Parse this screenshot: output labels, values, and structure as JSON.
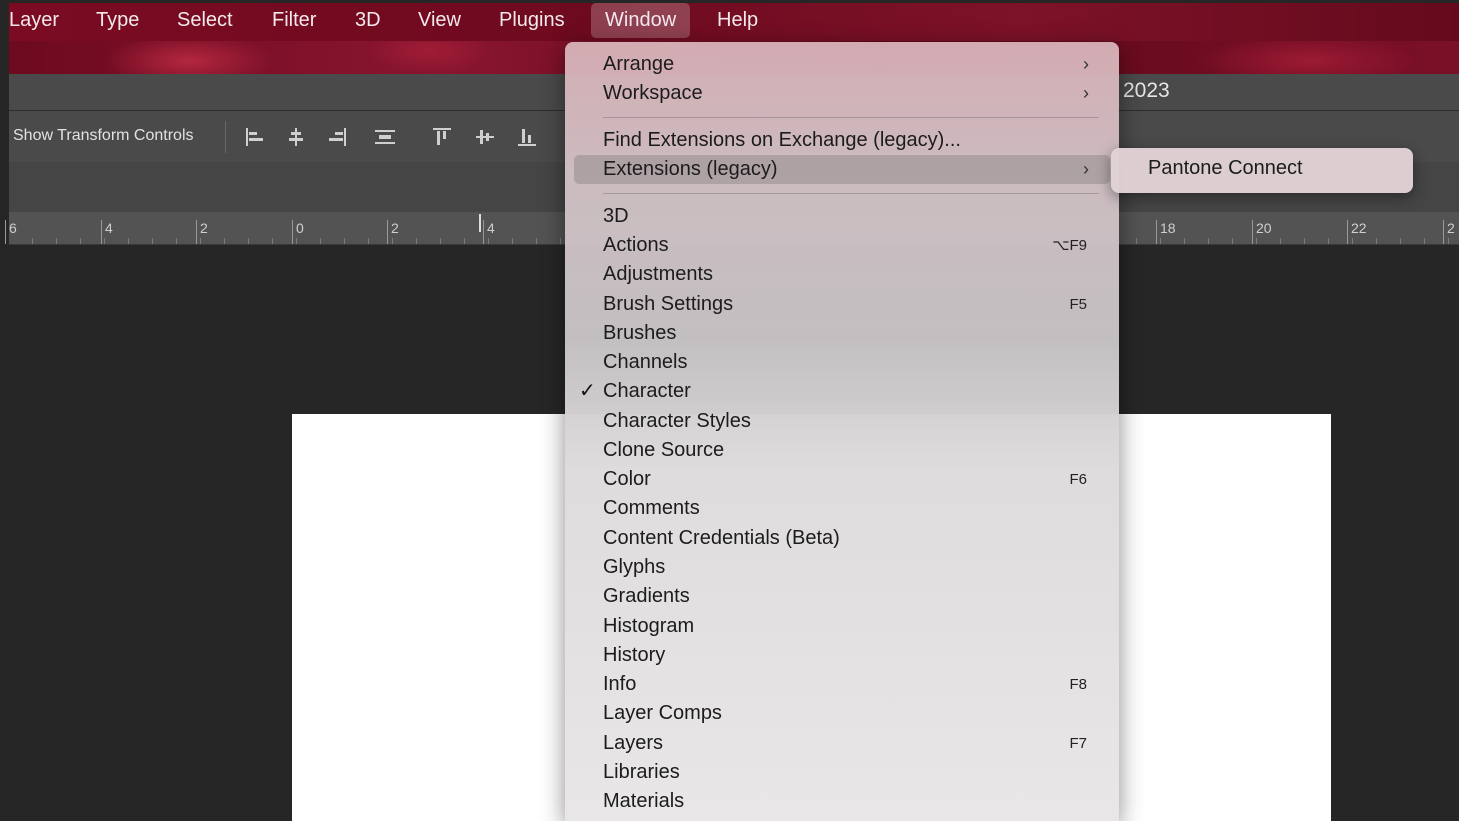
{
  "menubar": {
    "items": [
      "Layer",
      "Type",
      "Select",
      "Filter",
      "3D",
      "View",
      "Plugins",
      "Window",
      "Help"
    ],
    "active": "Window"
  },
  "title_fragment": "2023",
  "options_bar": {
    "show_transform_controls": "Show Transform Controls",
    "align_icons": [
      "align-left-edges-icon",
      "align-horizontal-centers-icon",
      "align-right-edges-icon",
      "distribute-horizontal-icon",
      "align-top-edges-icon",
      "align-vertical-centers-icon",
      "align-bottom-edges-icon"
    ]
  },
  "ruler": {
    "ticks": [
      "6",
      "4",
      "2",
      "0",
      "2",
      "4",
      "18",
      "20",
      "22",
      "2"
    ]
  },
  "window_menu": {
    "items": [
      {
        "label": "Arrange",
        "submenu": true
      },
      {
        "label": "Workspace",
        "submenu": true
      },
      {
        "label": "Find Extensions on Exchange (legacy)..."
      },
      {
        "label": "Extensions (legacy)",
        "submenu": true,
        "highlighted": true
      },
      {
        "label": "3D"
      },
      {
        "label": "Actions",
        "shortcut": "⌥F9"
      },
      {
        "label": "Adjustments"
      },
      {
        "label": "Brush Settings",
        "shortcut": "F5"
      },
      {
        "label": "Brushes"
      },
      {
        "label": "Channels"
      },
      {
        "label": "Character",
        "checked": true
      },
      {
        "label": "Character Styles"
      },
      {
        "label": "Clone Source"
      },
      {
        "label": "Color",
        "shortcut": "F6"
      },
      {
        "label": "Comments"
      },
      {
        "label": "Content Credentials (Beta)"
      },
      {
        "label": "Glyphs"
      },
      {
        "label": "Gradients"
      },
      {
        "label": "Histogram"
      },
      {
        "label": "History"
      },
      {
        "label": "Info",
        "shortcut": "F8"
      },
      {
        "label": "Layer Comps"
      },
      {
        "label": "Layers",
        "shortcut": "F7"
      },
      {
        "label": "Libraries"
      },
      {
        "label": "Materials"
      }
    ]
  },
  "extensions_submenu": {
    "items": [
      "Pantone Connect"
    ]
  },
  "colors": {
    "menubar_bg": "#7a0b22",
    "workspace_bg": "#262626",
    "panel_bg": "#4a4a4a",
    "canvas_bg": "#ffffff"
  }
}
